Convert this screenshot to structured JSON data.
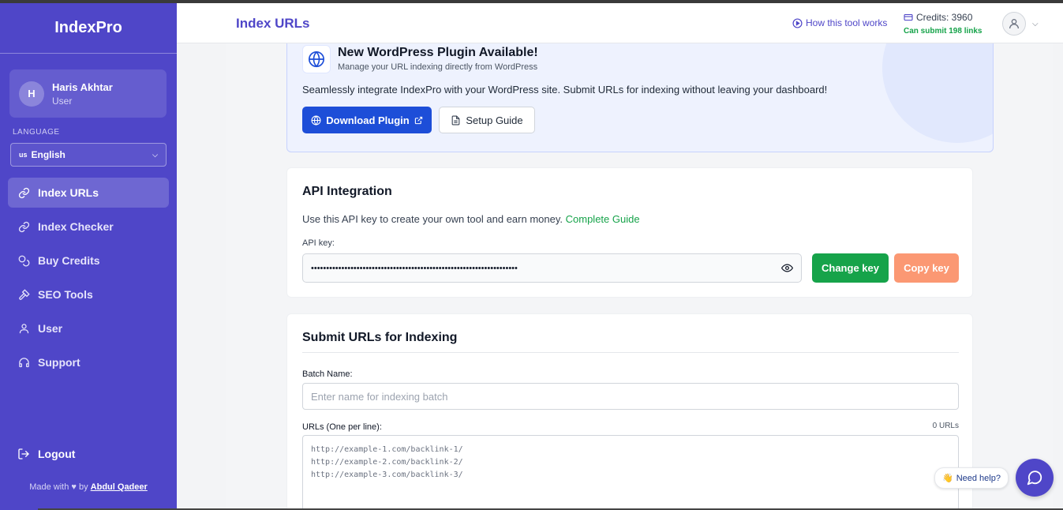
{
  "app": {
    "brand": "IndexPro"
  },
  "user": {
    "initial": "H",
    "name": "Haris Akhtar",
    "role": "User"
  },
  "language": {
    "label": "LANGUAGE",
    "flag": "us",
    "selected": "English"
  },
  "sidebar": {
    "items": [
      {
        "label": "Index URLs",
        "icon": "link-icon",
        "active": true
      },
      {
        "label": "Index Checker",
        "icon": "link-icon",
        "active": false
      },
      {
        "label": "Buy Credits",
        "icon": "coins-icon",
        "active": false
      },
      {
        "label": "SEO Tools",
        "icon": "hammer-icon",
        "active": false
      },
      {
        "label": "User",
        "icon": "user-icon",
        "active": false
      },
      {
        "label": "Support",
        "icon": "headset-icon",
        "active": false
      }
    ],
    "logout": "Logout",
    "made_with": "Made with ♥ by",
    "author": "Abdul Qadeer"
  },
  "header": {
    "title": "Index URLs",
    "how_link": "How this tool works",
    "credits": "Credits: 3960",
    "credits_sub": "Can submit 198 links"
  },
  "wp_banner": {
    "title": "New WordPress Plugin Available!",
    "subtitle": "Manage your URL indexing directly from WordPress",
    "description": "Seamlessly integrate IndexPro with your WordPress site. Submit URLs for indexing without leaving your dashboard!",
    "download_label": "Download Plugin",
    "guide_label": "Setup Guide"
  },
  "api": {
    "title": "API Integration",
    "description": "Use this API key to create your own tool and earn money.",
    "guide_link": "Complete Guide",
    "key_label": "API key:",
    "key_masked": "••••••••••••••••••••••••••••••••••••••••••••••••••••••••••••••••••••",
    "change_label": "Change key",
    "copy_label": "Copy key"
  },
  "submit": {
    "title": "Submit URLs for Indexing",
    "batch_label": "Batch Name:",
    "batch_placeholder": "Enter name for indexing batch",
    "urls_label": "URLs (One per line):",
    "url_count": "0 URLs",
    "url_placeholder_lines": [
      "http://example-1.com/backlink-1/",
      "http://example-2.com/backlink-2/",
      "http://example-3.com/backlink-3/"
    ]
  },
  "help": {
    "label": "Need help?"
  },
  "colors": {
    "brand": "#4f46c8",
    "primary": "#1d4ed8",
    "success": "#16a34a",
    "copy": "#fb9873"
  }
}
